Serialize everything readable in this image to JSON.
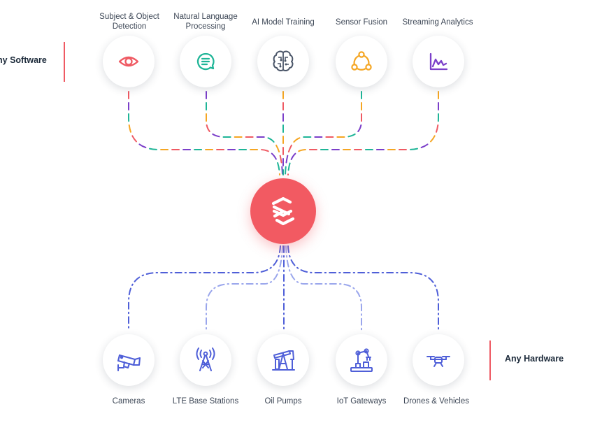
{
  "software": {
    "side_label": "Any Software",
    "items": [
      {
        "label": "Subject & Object\nDetection",
        "icon": "eye-icon",
        "color": "#ef5a63"
      },
      {
        "label": "Natural Language\nProcessing",
        "icon": "chat-bubble-icon",
        "color": "#1fb597"
      },
      {
        "label": "AI Model Training",
        "icon": "brain-icon",
        "color": "#4a5568"
      },
      {
        "label": "Sensor Fusion",
        "icon": "nodes-icon",
        "color": "#f5a623"
      },
      {
        "label": "Streaming Analytics",
        "icon": "line-chart-icon",
        "color": "#7b3fc9"
      }
    ]
  },
  "hardware": {
    "side_label": "Any Hardware",
    "items": [
      {
        "label": "Cameras",
        "icon": "security-camera-icon"
      },
      {
        "label": "LTE Base Stations",
        "icon": "cell-tower-icon"
      },
      {
        "label": "Oil Pumps",
        "icon": "oil-pump-icon"
      },
      {
        "label": "IoT Gateways",
        "icon": "robot-arm-icon"
      },
      {
        "label": "Drones & Vehicles",
        "icon": "drone-icon"
      }
    ],
    "icon_color": "#4f5fd8"
  },
  "hub": {
    "icon": "logo-icon",
    "color": "#f25a62"
  },
  "colors": {
    "line_blue": "#4f5fd8",
    "line_light_blue": "#9aa6ec",
    "line_red": "#ef5a63",
    "line_teal": "#1fb597",
    "line_purple": "#7b3fc9",
    "line_orange": "#f5a623",
    "side_accent": "#ef5a63"
  }
}
